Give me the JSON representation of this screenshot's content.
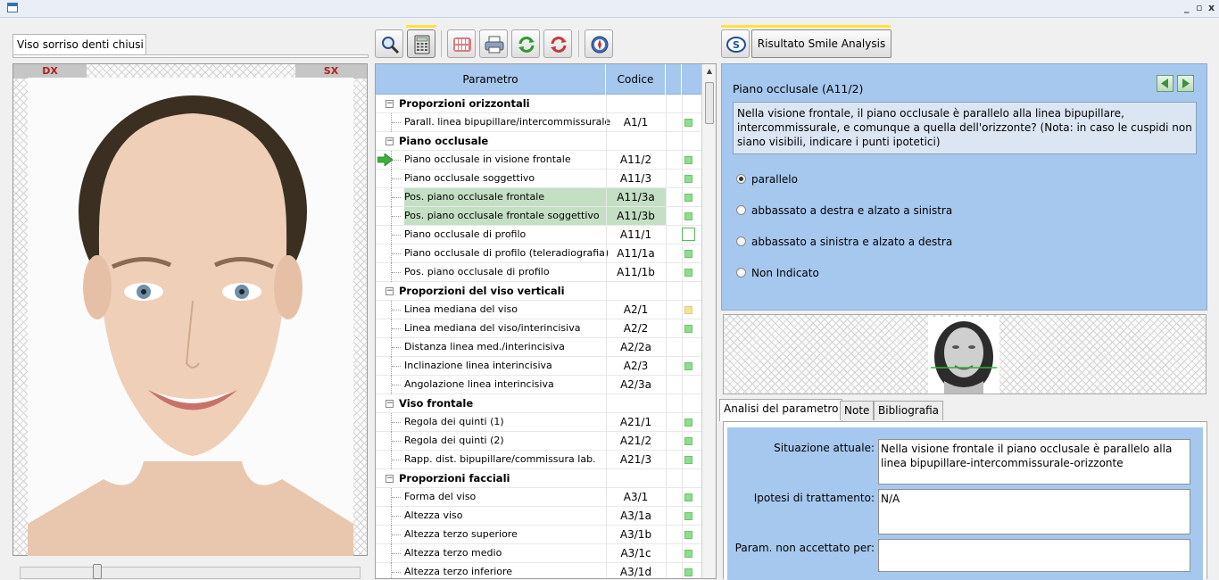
{
  "window": {
    "controls": [
      "_",
      "▫",
      "x"
    ]
  },
  "left_panel": {
    "tab_label": "Viso sorriso denti chiusi",
    "side_right": "DX",
    "side_left": "SX",
    "slider_value": 0.22
  },
  "toolbar": {
    "icons": [
      "zoom-icon",
      "calculator-icon",
      "teeth-icon",
      "printer-icon",
      "refresh-icon",
      "reset-icon",
      "compass-icon"
    ]
  },
  "table": {
    "headers": {
      "parametro": "Parametro",
      "codice": "Codice"
    },
    "groups": [
      {
        "label": "Proporzioni orizzontali",
        "items": [
          {
            "name": "Parall. linea bipupillare/intercommissurale",
            "code": "A1/1",
            "status": "green"
          }
        ]
      },
      {
        "label": "Piano occlusale",
        "items": [
          {
            "name": "Piano occlusale in visione frontale",
            "code": "A11/2",
            "status": "green",
            "current": true
          },
          {
            "name": "Piano occlusale soggettivo",
            "code": "A11/3",
            "status": "green"
          },
          {
            "name": "Pos. piano occlusale frontale",
            "code": "A11/3a",
            "status": "green",
            "highlight": true
          },
          {
            "name": "Pos. piano occlusale frontale soggettivo",
            "code": "A11/3b",
            "status": "green",
            "highlight": true
          },
          {
            "name": "Piano occlusale di profilo",
            "code": "A11/1",
            "status": "outline"
          },
          {
            "name": "Piano occlusale di profilo (teleradiografia)",
            "code": "A11/1a",
            "status": "green"
          },
          {
            "name": "Pos. piano occlusale di profilo",
            "code": "A11/1b",
            "status": "green"
          }
        ]
      },
      {
        "label": "Proporzioni del viso verticali",
        "items": [
          {
            "name": "Linea mediana del viso",
            "code": "A2/1",
            "status": "yellow"
          },
          {
            "name": "Linea mediana del viso/interincisiva",
            "code": "A2/2",
            "status": "green"
          },
          {
            "name": "Distanza linea med./interincisiva",
            "code": "A2/2a",
            "status": "none"
          },
          {
            "name": "Inclinazione linea interincisiva",
            "code": "A2/3",
            "status": "green"
          },
          {
            "name": "Angolazione linea interincisiva",
            "code": "A2/3a",
            "status": "none"
          }
        ]
      },
      {
        "label": "Viso frontale",
        "items": [
          {
            "name": "Regola dei quinti (1)",
            "code": "A21/1",
            "status": "green"
          },
          {
            "name": "Regola dei quinti (2)",
            "code": "A21/2",
            "status": "green"
          },
          {
            "name": "Rapp. dist. bipupillare/commissura lab.",
            "code": "A21/3",
            "status": "green"
          }
        ]
      },
      {
        "label": "Proporzioni facciali",
        "items": [
          {
            "name": "Forma del viso",
            "code": "A3/1",
            "status": "green"
          },
          {
            "name": "Altezza viso",
            "code": "A3/1a",
            "status": "green"
          },
          {
            "name": "Altezza terzo superiore",
            "code": "A3/1b",
            "status": "green"
          },
          {
            "name": "Altezza terzo medio",
            "code": "A3/1c",
            "status": "green"
          },
          {
            "name": "Altezza terzo inferiore",
            "code": "A3/1d",
            "status": "green"
          }
        ]
      }
    ]
  },
  "right_panel": {
    "result_button": "Risultato Smile Analysis",
    "question_title": "Piano occlusale (A11/2)",
    "question_text": "Nella visione frontale, il piano occlusale è parallelo alla linea bipupillare, intercommissurale, e comunque a quella dell'orizzonte? (Nota: in caso le cuspidi non siano visibili, indicare i punti ipotetici)",
    "options": [
      {
        "label": "parallelo",
        "selected": true
      },
      {
        "label": "abbassato a destra e alzato a sinistra",
        "selected": false
      },
      {
        "label": "abbassato a sinistra e alzato a destra",
        "selected": false
      },
      {
        "label": "Non Indicato",
        "selected": false
      }
    ],
    "tabs": [
      "Analisi del parametro",
      "Note",
      "Bibliografia"
    ],
    "active_tab": 0,
    "fields": {
      "situazione_label": "Situazione attuale:",
      "situazione_value": "Nella visione frontale il piano occlusale è parallelo alla linea bipupillare-intercommissurale-orizzonte",
      "ipotesi_label": "Ipotesi di trattamento:",
      "ipotesi_value": "N/A",
      "param_label": "Param. non accettato per:",
      "param_value": ""
    }
  }
}
